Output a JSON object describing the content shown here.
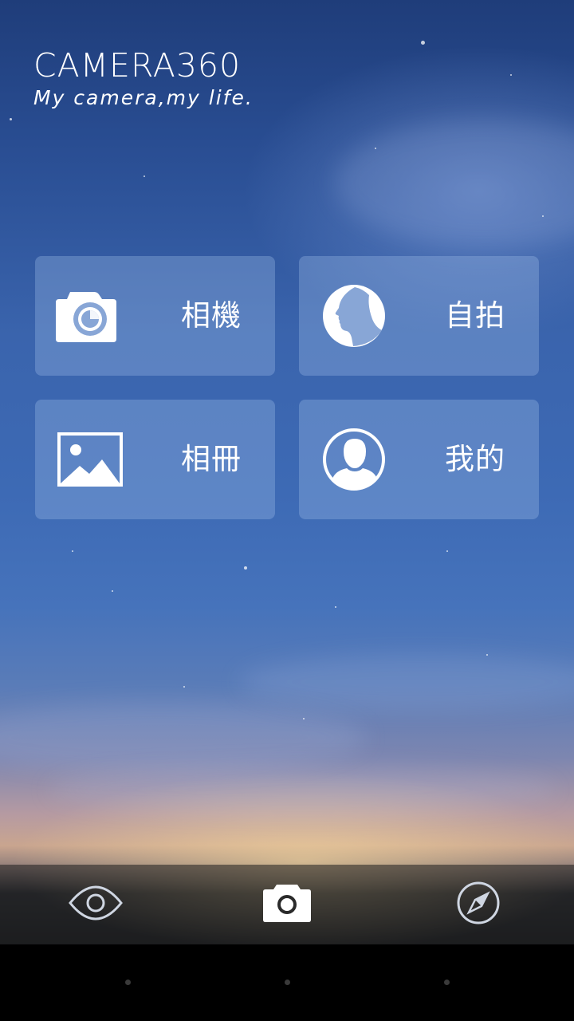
{
  "app": {
    "brand_title": "CAMERA360",
    "brand_tagline": "My camera,my life."
  },
  "tiles": [
    {
      "label": "相機",
      "icon": "camera-icon"
    },
    {
      "label": "自拍",
      "icon": "selfie-face-icon"
    },
    {
      "label": "相冊",
      "icon": "gallery-icon"
    },
    {
      "label": "我的",
      "icon": "profile-icon"
    }
  ],
  "bottom_bar": {
    "items": [
      {
        "icon": "eye-icon"
      },
      {
        "icon": "camera-icon",
        "active": true
      },
      {
        "icon": "compass-icon"
      }
    ]
  },
  "system_nav": {
    "items": [
      "back-dot",
      "home-dot",
      "recent-dot"
    ]
  },
  "colors": {
    "tile_bg": "rgba(160,190,235,0.33)",
    "text": "#ffffff",
    "bottom_bar_bg": "#1e1e1e"
  }
}
